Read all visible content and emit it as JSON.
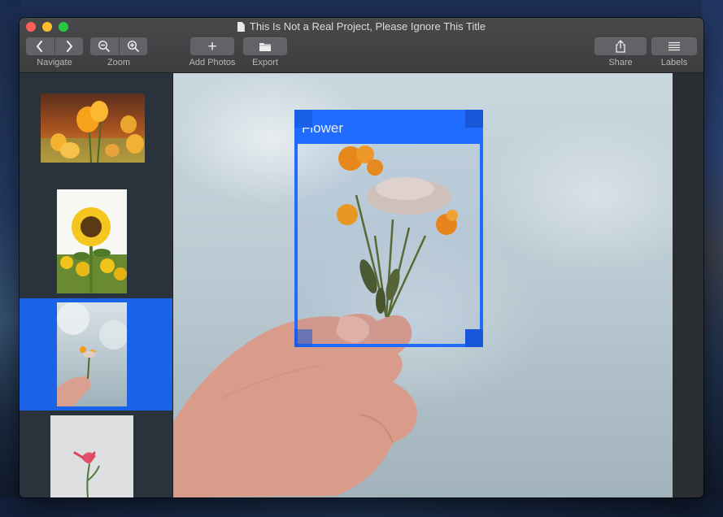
{
  "window": {
    "title": "This Is Not a Real Project, Please Ignore This Title"
  },
  "toolbar": {
    "navigate_label": "Navigate",
    "zoom_label": "Zoom",
    "add_photos_label": "Add Photos",
    "export_label": "Export",
    "share_label": "Share",
    "labels_label": "Labels",
    "add_glyph": "+"
  },
  "sidebar": {
    "selected_index": 2,
    "items": [
      {
        "name": "tulips"
      },
      {
        "name": "sunflower"
      },
      {
        "name": "hand-holding-flower"
      },
      {
        "name": "pink-flower"
      }
    ]
  },
  "annotation": {
    "label": "Flower",
    "color": "#1f6cff"
  },
  "colors": {
    "selection": "#1b63e6",
    "sidebar_bg": "#2a323c",
    "toolbar_bg": "#3c3d3f"
  }
}
